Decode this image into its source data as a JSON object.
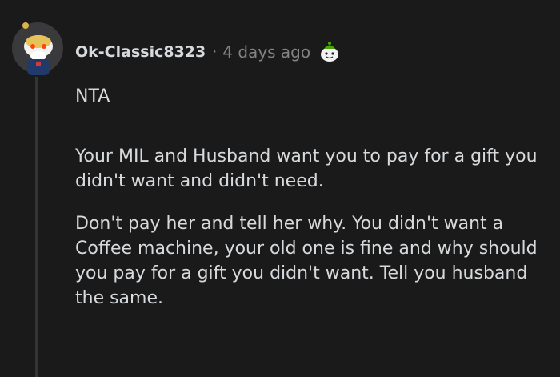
{
  "comment": {
    "username": "Ok-Classic8323",
    "separator": "·",
    "timestamp": "4 days ago",
    "award_icon": "award-icon",
    "avatar_icon": "user-avatar",
    "paragraphs": [
      "NTA",
      "Your MIL and Husband want you to pay for a gift you didn't want and didn't need.",
      "Don't pay her and tell her why. You didn't want a Coffee machine, your old one is fine and why should you pay for a gift you didn't want. Tell you husband the same."
    ]
  },
  "colors": {
    "background": "#1a1a1b",
    "text": "#d7dadc",
    "meta": "#818384",
    "thread_line": "#343536"
  }
}
